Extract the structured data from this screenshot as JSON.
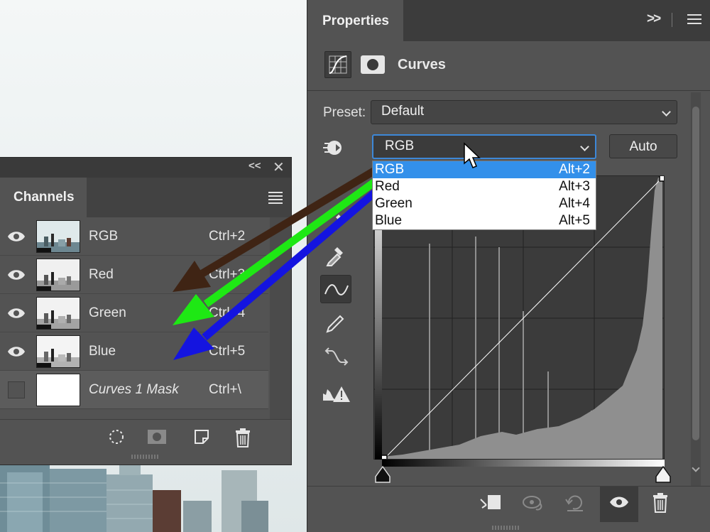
{
  "properties_panel": {
    "tab_label": "Properties",
    "adjustment_title": "Curves",
    "preset_label": "Preset:",
    "preset_value": "Default",
    "channel_value": "RGB",
    "auto_label": "Auto",
    "channel_menu": [
      {
        "label": "RGB",
        "shortcut": "Alt+2",
        "selected": true
      },
      {
        "label": "Red",
        "shortcut": "Alt+3",
        "selected": false
      },
      {
        "label": "Green",
        "shortcut": "Alt+4",
        "selected": false
      },
      {
        "label": "Blue",
        "shortcut": "Alt+5",
        "selected": false
      }
    ],
    "tools": [
      "on-image-adjust-icon",
      "black-point-eyedropper-icon",
      "gray-point-eyedropper-icon",
      "white-point-eyedropper-icon",
      "curve-edit-points-icon",
      "pencil-draw-icon",
      "smooth-curve-icon",
      "clipping-warning-icon"
    ],
    "footer_buttons": [
      "clip-to-layer-icon",
      "view-previous-state-icon",
      "reset-icon",
      "visibility-eye-icon",
      "trash-icon"
    ]
  },
  "channels_panel": {
    "tab_label": "Channels",
    "rows": [
      {
        "name": "RGB",
        "shortcut": "Ctrl+2",
        "visible": true,
        "italic": false
      },
      {
        "name": "Red",
        "shortcut": "Ctrl+3",
        "visible": true,
        "italic": false
      },
      {
        "name": "Green",
        "shortcut": "Ctrl+4",
        "visible": true,
        "italic": false
      },
      {
        "name": "Blue",
        "shortcut": "Ctrl+5",
        "visible": true,
        "italic": false
      },
      {
        "name": "Curves 1 Mask",
        "shortcut": "Ctrl+\\",
        "visible": false,
        "italic": true
      }
    ],
    "footer_buttons": [
      "load-selection-icon",
      "save-selection-mask-icon",
      "new-channel-icon",
      "delete-channel-icon"
    ]
  },
  "colors": {
    "panel_bg": "#535353",
    "accent_blue": "#3390ea",
    "arrow_brown": "#3f2414",
    "arrow_green": "#1ee814",
    "arrow_blue": "#1414e0"
  }
}
